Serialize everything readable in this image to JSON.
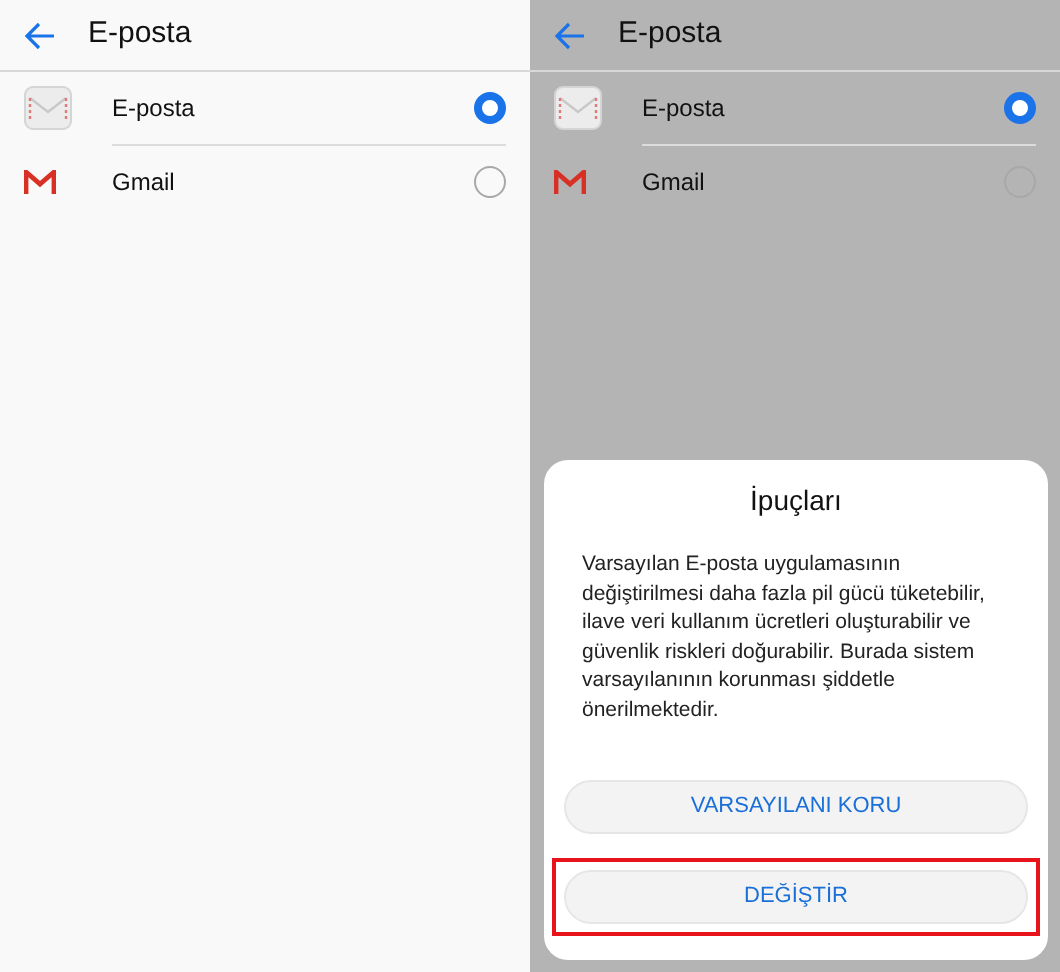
{
  "screens": [
    {
      "title": "E-posta",
      "dimmed": false,
      "apps": [
        {
          "kind": "mail",
          "label": "E-posta",
          "selected": true
        },
        {
          "kind": "gmail",
          "label": "Gmail",
          "selected": false
        }
      ]
    },
    {
      "title": "E-posta",
      "dimmed": true,
      "apps": [
        {
          "kind": "mail",
          "label": "E-posta",
          "selected": true
        },
        {
          "kind": "gmail",
          "label": "Gmail",
          "selected": false
        }
      ],
      "dialog": {
        "title": "İpuçları",
        "message": "Varsayılan E-posta uygulamasının değiştirilmesi daha fazla pil gücü tüketebilir, ilave veri kullanım ücretleri oluşturabilir ve güvenlik riskleri doğurabilir. Burada sistem varsayılanının korunması şiddetle önerilmektedir.",
        "buttons": [
          {
            "label": "VARSAYILANI KORU",
            "highlighted": false
          },
          {
            "label": "DEĞİŞTİR",
            "highlighted": true
          }
        ]
      }
    }
  ]
}
